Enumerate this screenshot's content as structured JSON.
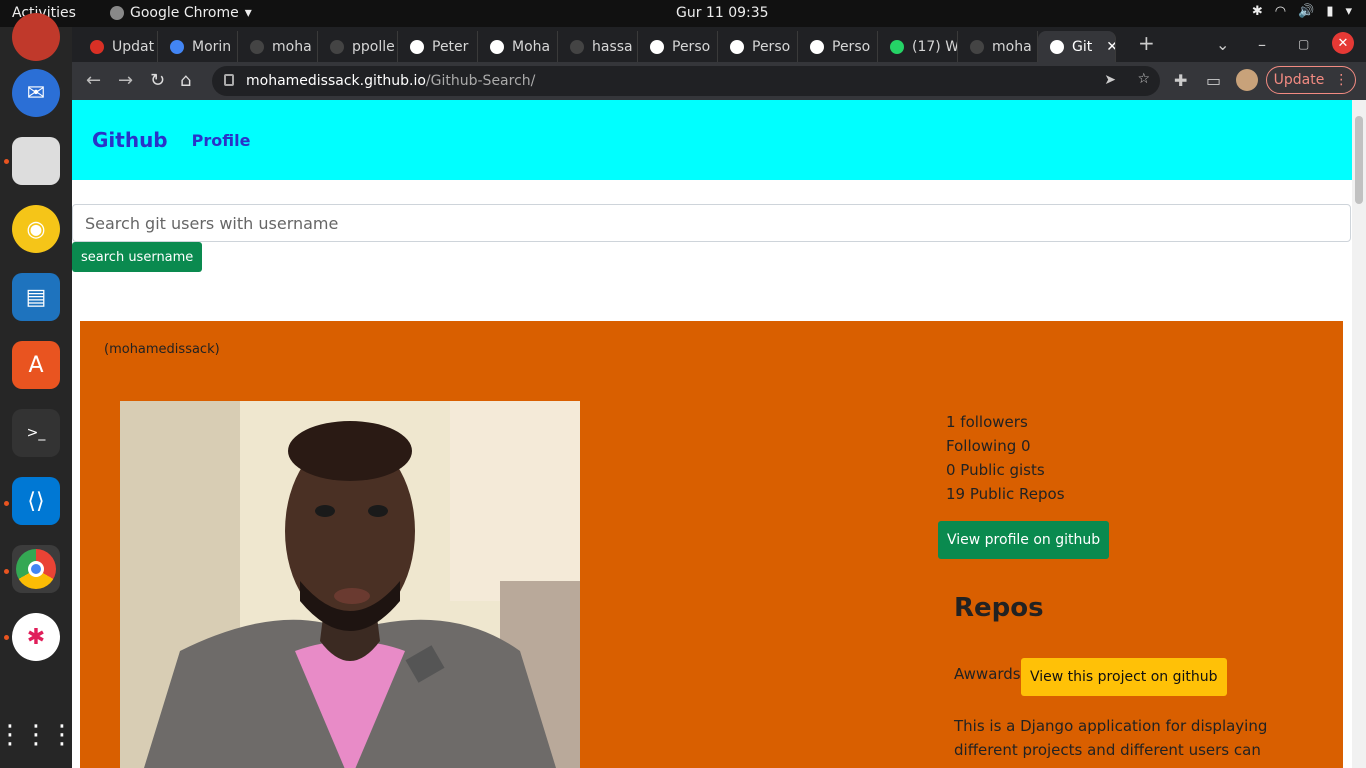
{
  "system": {
    "activities": "Activities",
    "app_name": "Google Chrome",
    "clock": "Gur 11  09:35"
  },
  "tabs": [
    {
      "label": "Updat",
      "fav_color": "#d93025"
    },
    {
      "label": "Morin",
      "fav_color": "#4285f4"
    },
    {
      "label": "moha",
      "fav_color": "#444444"
    },
    {
      "label": "ppolle",
      "fav_color": "#444444"
    },
    {
      "label": "Peter",
      "fav_color": "#ffffff"
    },
    {
      "label": "Moha",
      "fav_color": "#ffffff"
    },
    {
      "label": "hassa",
      "fav_color": "#444444"
    },
    {
      "label": "Perso",
      "fav_color": "#ffffff"
    },
    {
      "label": "Perso",
      "fav_color": "#ffffff"
    },
    {
      "label": "Perso",
      "fav_color": "#ffffff"
    },
    {
      "label": "(17) W",
      "fav_color": "#25d366"
    },
    {
      "label": "moha",
      "fav_color": "#444444"
    },
    {
      "label": "Git",
      "fav_color": "#ffffff"
    }
  ],
  "toolbar": {
    "url_host": "mohamedissack.github.io",
    "url_path": "/Github-Search/",
    "update_label": "Update"
  },
  "navbar": {
    "brand": "Github",
    "link": "Profile"
  },
  "search": {
    "placeholder": "Search git users with username",
    "button": "search username"
  },
  "profile": {
    "username": "(mohamedissack)",
    "followers": "1 followers",
    "following": "Following 0",
    "gists": "0 Public gists",
    "repos_count": "19 Public Repos",
    "view_profile": "View profile on github"
  },
  "repos": {
    "title": "Repos",
    "item_name": "Awwards",
    "item_button": "View this project on github",
    "item_description": "This is a Django application for displaying different projects and different users can"
  },
  "colors": {
    "navbar": "#00ffff",
    "card": "#d95f00",
    "green_button": "#0a8a4f",
    "yellow_button": "#ffc107"
  }
}
